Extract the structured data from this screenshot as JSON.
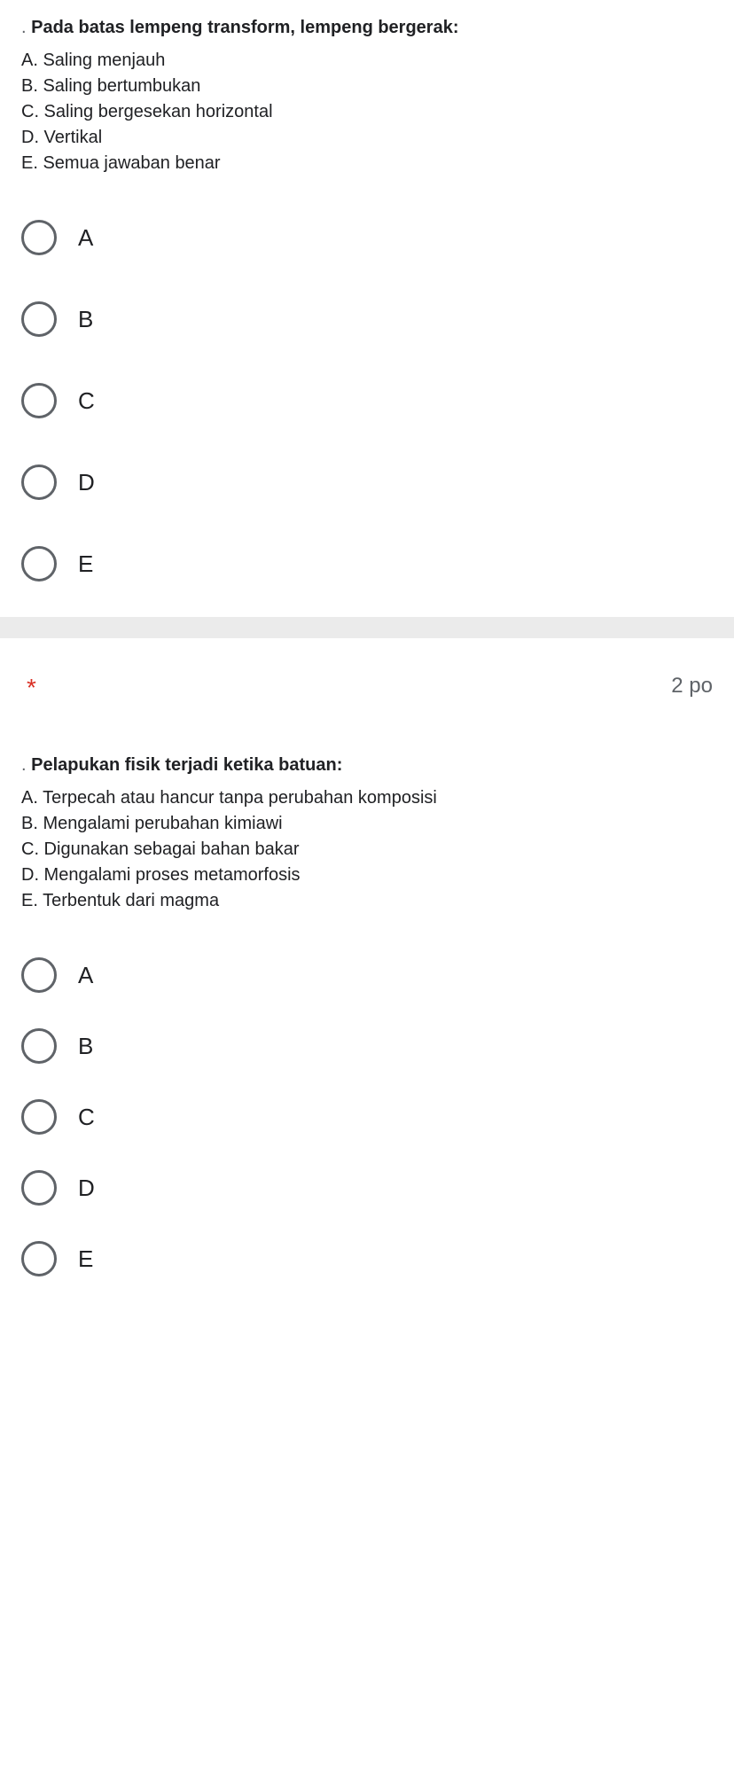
{
  "question1": {
    "title": "Pada batas lempeng transform, lempeng bergerak:",
    "answers": {
      "a": "A. Saling menjauh",
      "b": "B. Saling bertumbukan",
      "c": "C. Saling bergesekan horizontal",
      "d": "D. Vertikal",
      "e": "E. Semua jawaban benar"
    },
    "options": {
      "a": "A",
      "b": "B",
      "c": "C",
      "d": "D",
      "e": "E"
    }
  },
  "required_marker": "*",
  "points_label": "2 po",
  "question2": {
    "title": "Pelapukan fisik terjadi ketika batuan:",
    "answers": {
      "a": "A. Terpecah atau hancur tanpa perubahan komposisi",
      "b": "B. Mengalami perubahan kimiawi",
      "c": "C. Digunakan sebagai bahan bakar",
      "d": "D. Mengalami proses metamorfosis",
      "e": "E. Terbentuk dari magma"
    },
    "options": {
      "a": "A",
      "b": "B",
      "c": "C",
      "d": "D",
      "e": "E"
    }
  }
}
